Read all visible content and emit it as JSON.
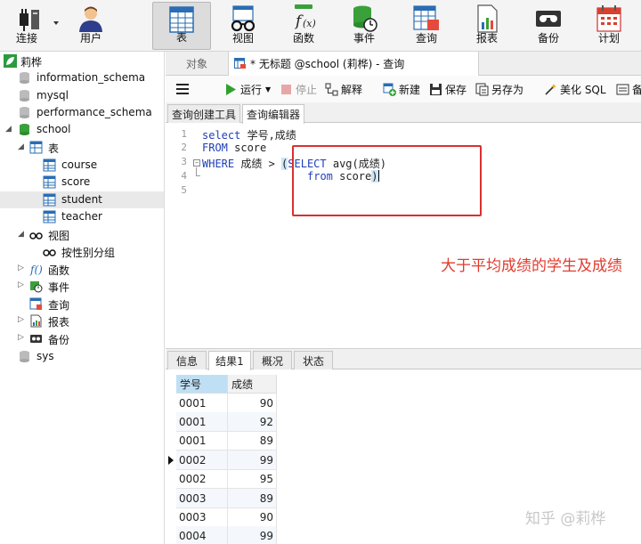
{
  "toolbar": {
    "items": [
      {
        "label": "连接",
        "icon": "plug-icon"
      },
      {
        "label": "用户",
        "icon": "user-icon"
      },
      {
        "label": "表",
        "icon": "table-icon",
        "active": true
      },
      {
        "label": "视图",
        "icon": "glasses-icon"
      },
      {
        "label": "函数",
        "icon": "function-icon"
      },
      {
        "label": "事件",
        "icon": "event-icon"
      },
      {
        "label": "查询",
        "icon": "query-icon"
      },
      {
        "label": "报表",
        "icon": "report-icon"
      },
      {
        "label": "备份",
        "icon": "backup-icon"
      },
      {
        "label": "计划",
        "icon": "calendar-icon"
      }
    ]
  },
  "tree": {
    "nodes": [
      {
        "label": "莉桦"
      },
      {
        "label": "information_schema"
      },
      {
        "label": "mysql"
      },
      {
        "label": "performance_schema"
      },
      {
        "label": "school"
      },
      {
        "label": "表"
      },
      {
        "label": "course"
      },
      {
        "label": "score"
      },
      {
        "label": "student",
        "selected": true
      },
      {
        "label": "teacher"
      },
      {
        "label": "视图"
      },
      {
        "label": "按性别分组"
      },
      {
        "label": "函数"
      },
      {
        "label": "事件"
      },
      {
        "label": "查询"
      },
      {
        "label": "报表"
      },
      {
        "label": "备份"
      },
      {
        "label": "sys"
      }
    ]
  },
  "doc_tabs": {
    "object": "对象",
    "query": "* 无标题 @school (莉桦) - 查询"
  },
  "query_toolbar": {
    "run": "运行",
    "stop": "停止",
    "explain": "解释",
    "new": "新建",
    "save": "保存",
    "save_as": "另存为",
    "beautify": "美化 SQL",
    "more": "备"
  },
  "sub_tabs": {
    "builder": "查询创建工具",
    "editor": "查询编辑器"
  },
  "editor": {
    "line_numbers": [
      "1",
      "2",
      "3",
      "4",
      "5"
    ],
    "l1_kw": "select",
    "l1_rest": " 学号,成绩",
    "l2_kw": "FROM",
    "l2_rest": " score",
    "l3_kw": "WHERE",
    "l3_rest": " 成绩 > ",
    "l3_open": "(",
    "l3_kw2": "SELECT",
    "l3_rest2": " avg(成绩)",
    "l4_kw": "from",
    "l4_rest": " score",
    "l4_close": ")",
    "fold_sign": "−"
  },
  "annotation": "大于平均成绩的学生及成绩",
  "result_tabs": {
    "info": "信息",
    "result1": "结果1",
    "overview": "概况",
    "status": "状态"
  },
  "grid": {
    "headers": [
      "学号",
      "成绩"
    ],
    "rows": [
      {
        "id": "0001",
        "score": "90"
      },
      {
        "id": "0001",
        "score": "92"
      },
      {
        "id": "0001",
        "score": "89"
      },
      {
        "id": "0002",
        "score": "99",
        "current": true
      },
      {
        "id": "0002",
        "score": "95"
      },
      {
        "id": "0003",
        "score": "89"
      },
      {
        "id": "0003",
        "score": "90"
      },
      {
        "id": "0004",
        "score": "99"
      }
    ]
  },
  "watermark": "知乎 @莉桦",
  "colors": {
    "accent_red": "#e23b2e",
    "keyword_blue": "#1f3fb8",
    "run_green": "#2fa12f"
  }
}
